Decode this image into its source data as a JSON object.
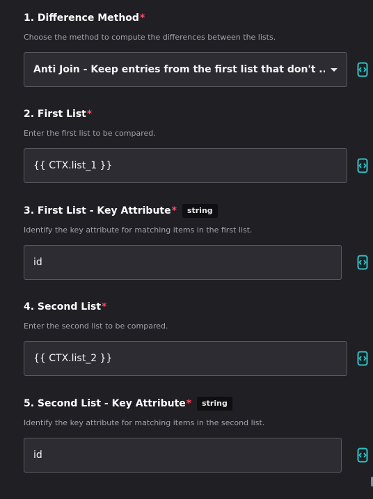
{
  "fields": [
    {
      "title": "1. Difference Method",
      "required": "*",
      "description": "Choose the method to compute the differences between the lists.",
      "value": "Anti Join - Keep entries from the first list that don't ..."
    },
    {
      "title": "2. First List",
      "required": "*",
      "description": "Enter the first list to be compared.",
      "value": "{{ CTX.list_1 }}"
    },
    {
      "title": "3. First List - Key Attribute",
      "required": "*",
      "badge": "string",
      "description": "Identify the key attribute for matching items in the first list.",
      "value": "id"
    },
    {
      "title": "4. Second List",
      "required": "*",
      "description": "Enter the second list to be compared.",
      "value": "{{ CTX.list_2 }}"
    },
    {
      "title": "5. Second List - Key Attribute",
      "required": "*",
      "badge": "string",
      "description": "Identify the key attribute for matching items in the second list.",
      "value": "id"
    }
  ],
  "icons": {
    "expression_toggle": "code-brackets-icon",
    "dropdown": "caret-down-icon"
  },
  "colors": {
    "background": "#1f1f24",
    "input_background": "#2c2c32",
    "input_border": "#5a5a62",
    "required": "#ff4d5e",
    "accent_icon": "#2ec4c4",
    "description": "#a3a3ab"
  }
}
